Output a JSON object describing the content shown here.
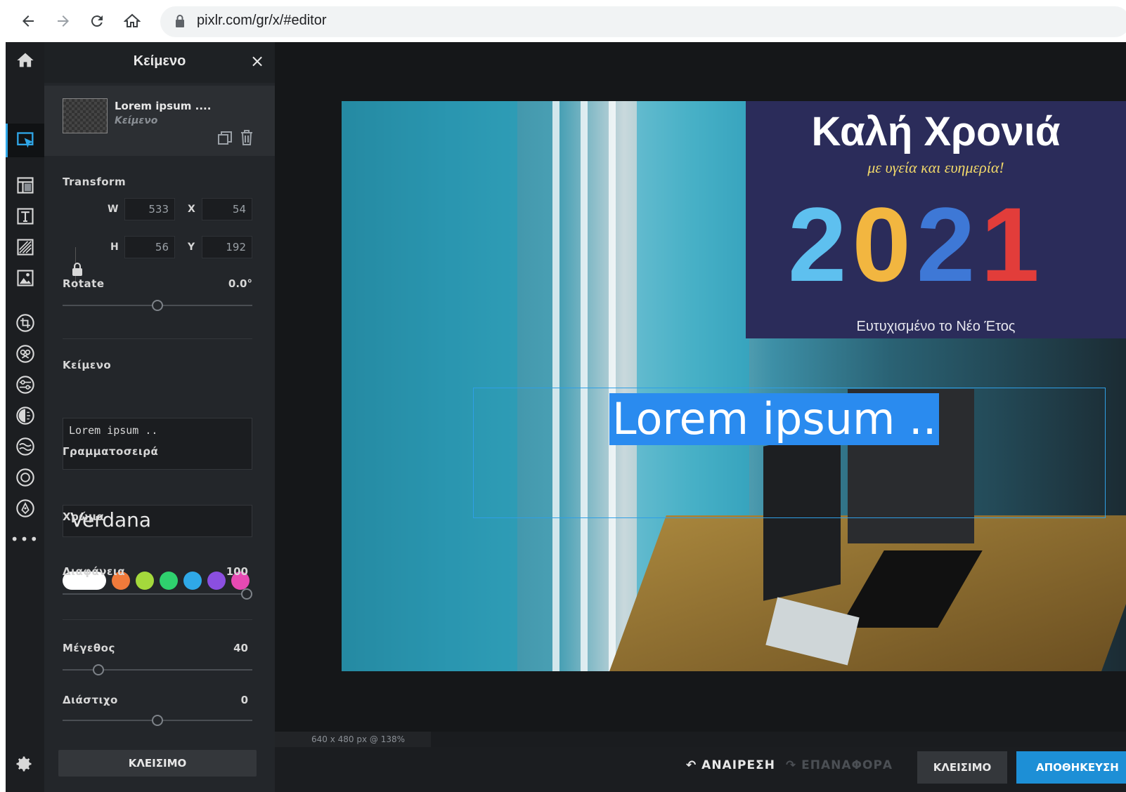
{
  "browser": {
    "url": "pixlr.com/gr/x/#editor",
    "icons": [
      "back-arrow-icon",
      "forward-arrow-icon",
      "reload-icon",
      "home-icon",
      "lock-icon"
    ]
  },
  "panel": {
    "title": "Κείμενο",
    "close_glyph": "×",
    "layer": {
      "name": "Lorem ipsum ....",
      "type": "Κείμενο"
    },
    "transform": {
      "label": "Transform",
      "w_label": "W",
      "w": "533",
      "x_label": "X",
      "x": "54",
      "h_label": "H",
      "h": "56",
      "y_label": "Y",
      "y": "192"
    },
    "rotate": {
      "label": "Rotate",
      "value": "0.0°",
      "fraction": 0.5
    },
    "text": {
      "label": "Κείμενο",
      "value": "Lorem ipsum .."
    },
    "font": {
      "label": "Γραμματοσειρά",
      "value": "Verdana"
    },
    "color": {
      "label": "Χρώμα",
      "swatches": [
        "#ffffff",
        "#f07a3b",
        "#a4d93c",
        "#2fd16e",
        "#2fa8e7",
        "#8b4fe0",
        "#e64ab3"
      ]
    },
    "opacity": {
      "label": "Διαφάνεια",
      "value": "100",
      "fraction": 1.0
    },
    "size": {
      "label": "Μέγεθος",
      "value": "40",
      "fraction": 0.17
    },
    "spacing": {
      "label": "Διάστιχο",
      "value": "0",
      "fraction": 0.5
    },
    "close_button": "ΚΛΕΙΣΙΜΟ"
  },
  "canvas": {
    "card_title": "Καλή Χρονιά",
    "card_subtitle": "με υγεία και ευημερία!",
    "card_year": [
      "2",
      "0",
      "2",
      "1"
    ],
    "card_footer": "Ευτυχισμένο το Νέο Έτος",
    "selected_text": "Lorem ipsum .."
  },
  "status": {
    "zoom": "640 x 480 px @ 138%"
  },
  "bottom": {
    "undo": "↶ ΑΝΑΙΡΕΣΗ",
    "redo": "↷ ΕΠΑΝΑΦΟΡΑ",
    "close": "ΚΛΕΙΣΙΜΟ",
    "save": "ΑΠΟΘΗΚΕΥΣΗ"
  },
  "colors": {
    "accent": "#1d8fd6",
    "selection": "#2a8bef",
    "panel": "#23262a"
  }
}
